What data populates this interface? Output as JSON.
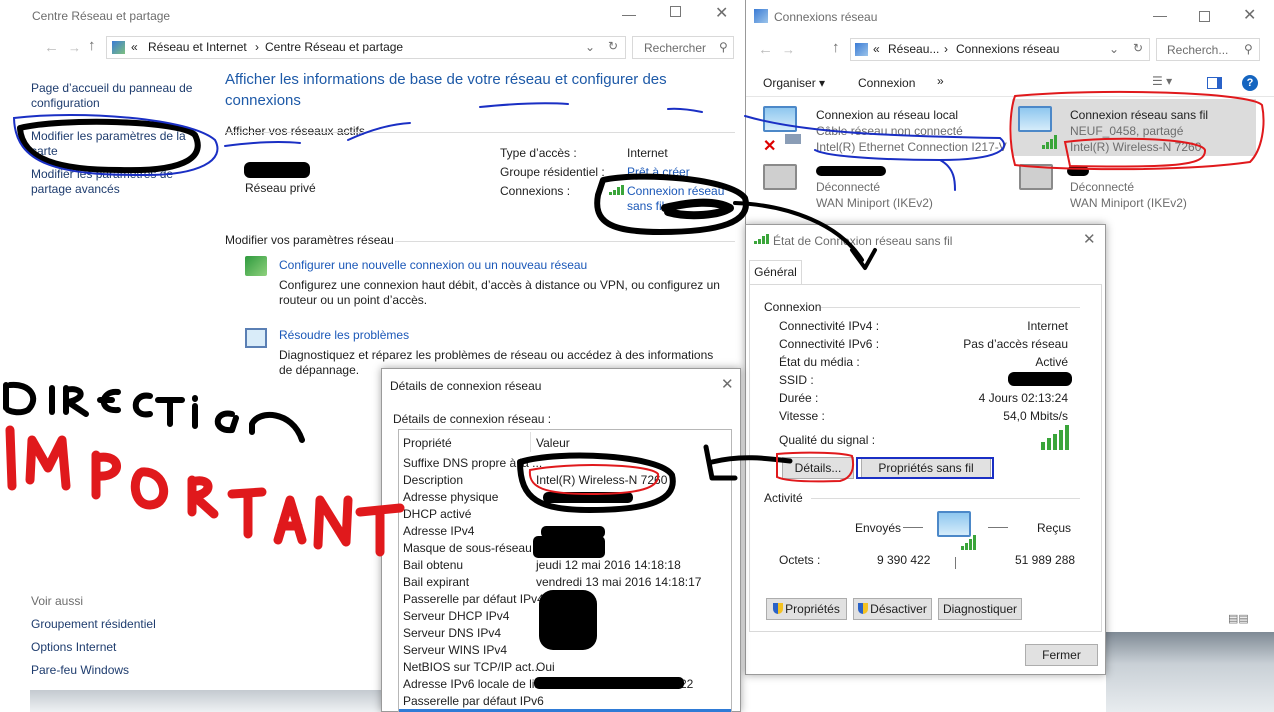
{
  "nsc": {
    "title": "Centre Réseau et partage",
    "breadcrumb": [
      "«",
      "Réseau et Internet",
      "›",
      "Centre Réseau et partage",
      "›"
    ],
    "search_placeholder": "Rechercher",
    "sidebar_links": [
      "Page d’accueil du panneau de configuration",
      "Modifier les paramètres de la carte",
      "Modifier les paramètres de partage avancés"
    ],
    "see_also_label": "Voir aussi",
    "see_also_links": [
      "Groupement résidentiel",
      "Options Internet",
      "Pare-feu Windows"
    ],
    "heading": "Afficher les informations de base de votre réseau et configurer des connexions",
    "active_networks_label": "Afficher vos réseaux actifs",
    "network_type": "Réseau privé",
    "access_type_label": "Type d’accès :",
    "access_type_value": "Internet",
    "homegroup_label": "Groupe résidentiel :",
    "homegroup_value": "Prêt à créer",
    "connections_label": "Connexions :",
    "connection_value": "Connexion réseau sans fil",
    "modify_settings_label": "Modifier vos paramètres réseau",
    "task1_link": "Configurer une nouvelle connexion ou un nouveau réseau",
    "task1_desc": "Configurez une connexion haut débit, d’accès à distance ou VPN, ou configurez un routeur ou un point d’accès.",
    "task2_link": "Résoudre les problèmes",
    "task2_desc": "Diagnostiquez et réparez les problèmes de réseau ou accédez à des informations de dépannage."
  },
  "netconn": {
    "title": "Connexions réseau",
    "breadcrumb": [
      "«",
      "Réseau...",
      "›",
      "Connexions réseau",
      "›"
    ],
    "search_placeholder": "Recherch...",
    "toolbar": [
      "Organiser",
      "Connexion",
      "»"
    ],
    "adapters": [
      {
        "name": "Connexion au réseau local",
        "status": "Câble réseau non connecté",
        "device": "Intel(R) Ethernet Connection I217-V"
      },
      {
        "name": "Connexion réseau sans fil",
        "status": "NEUF_0458, partagé",
        "device": "Intel(R) Wireless-N 7260"
      },
      {
        "name": "",
        "status": "Déconnecté",
        "device": "WAN Miniport (IKEv2)"
      },
      {
        "name": "",
        "status": "Déconnecté",
        "device": "WAN Miniport (IKEv2)"
      }
    ]
  },
  "status": {
    "title": "État de Connexion réseau sans fil",
    "tab": "Général",
    "connexion_group": "Connexion",
    "rows": [
      {
        "label": "Connectivité IPv4 :",
        "value": "Internet"
      },
      {
        "label": "Connectivité IPv6 :",
        "value": "Pas d’accès réseau"
      },
      {
        "label": "État du média :",
        "value": "Activé"
      },
      {
        "label": "SSID :",
        "value": ""
      },
      {
        "label": "Durée :",
        "value": "4 Jours 02:13:24"
      },
      {
        "label": "Vitesse :",
        "value": "54,0 Mbits/s"
      }
    ],
    "signal_label": "Qualité du signal :",
    "details_button": "Détails...",
    "wireless_props_button": "Propriétés sans fil",
    "activity_group": "Activité",
    "sent_label": "Envoyés",
    "received_label": "Reçus",
    "octets_label": "Octets :",
    "octets_sent": "9 390 422",
    "octets_received": "51 989 288",
    "properties_button": "Propriétés",
    "disable_button": "Désactiver",
    "diagnose_button": "Diagnostiquer",
    "close_button": "Fermer"
  },
  "details": {
    "title": "Détails de connexion réseau",
    "subtitle": "Détails de connexion réseau :",
    "col_property": "Propriété",
    "col_value": "Valeur",
    "rows": [
      {
        "p": "Suffixe DNS propre à la ...",
        "v": ""
      },
      {
        "p": "Description",
        "v": "Intel(R) Wireless-N 7260"
      },
      {
        "p": "Adresse physique",
        "v": ""
      },
      {
        "p": "DHCP activé",
        "v": ""
      },
      {
        "p": "Adresse IPv4",
        "v": ""
      },
      {
        "p": "Masque de sous-réseau ...",
        "v": ""
      },
      {
        "p": "Bail obtenu",
        "v": "jeudi 12 mai 2016 14:18:18"
      },
      {
        "p": "Bail expirant",
        "v": "vendredi 13 mai 2016 14:18:17"
      },
      {
        "p": "Passerelle par défaut IPv4",
        "v": ""
      },
      {
        "p": "Serveur DHCP IPv4",
        "v": ""
      },
      {
        "p": "Serveur DNS IPv4",
        "v": ""
      },
      {
        "p": "Serveur WINS IPv4",
        "v": ""
      },
      {
        "p": "NetBIOS sur TCP/IP act...",
        "v": "Oui"
      },
      {
        "p": "Adresse IPv6 locale de li...",
        "v": "22"
      },
      {
        "p": "Passerelle par défaut IPv6",
        "v": ""
      }
    ]
  },
  "annotations": {
    "line1": "DIRECTION",
    "line2": "IMPORTANT"
  },
  "colors": {
    "accent": "#1b58b8",
    "ink_red": "#e0191c",
    "ink_blue": "#1a2fc4"
  }
}
